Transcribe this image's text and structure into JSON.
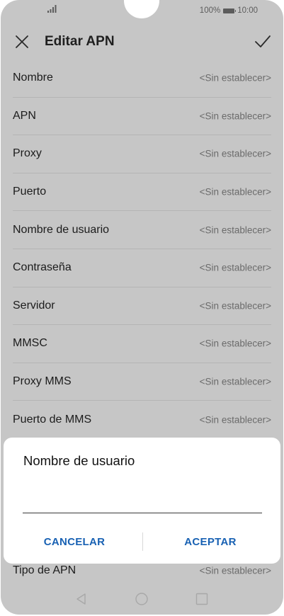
{
  "status_bar": {
    "battery_text": "100%",
    "time": "10:00"
  },
  "header": {
    "title": "Editar APN",
    "close_icon": "close-icon",
    "confirm_icon": "check-icon"
  },
  "rows": [
    {
      "label": "Nombre",
      "value": "<Sin establecer>"
    },
    {
      "label": "APN",
      "value": "<Sin establecer>"
    },
    {
      "label": "Proxy",
      "value": "<Sin establecer>"
    },
    {
      "label": "Puerto",
      "value": "<Sin establecer>"
    },
    {
      "label": "Nombre de usuario",
      "value": "<Sin establecer>"
    },
    {
      "label": "Contraseña",
      "value": "<Sin establecer>"
    },
    {
      "label": "Servidor",
      "value": "<Sin establecer>"
    },
    {
      "label": "MMSC",
      "value": "<Sin establecer>"
    },
    {
      "label": "Proxy MMS",
      "value": "<Sin establecer>"
    },
    {
      "label": "Puerto de MMS",
      "value": "<Sin establecer>"
    }
  ],
  "bottom_row": {
    "label": "Tipo de APN",
    "value": "<Sin establecer>"
  },
  "dialog": {
    "title": "Nombre de usuario",
    "input_value": "",
    "cancel_label": "CANCELAR",
    "accept_label": "ACEPTAR"
  },
  "colors": {
    "accent": "#1861b3",
    "overlay": "#c6c6c6",
    "dialog_bg": "#ffffff"
  }
}
